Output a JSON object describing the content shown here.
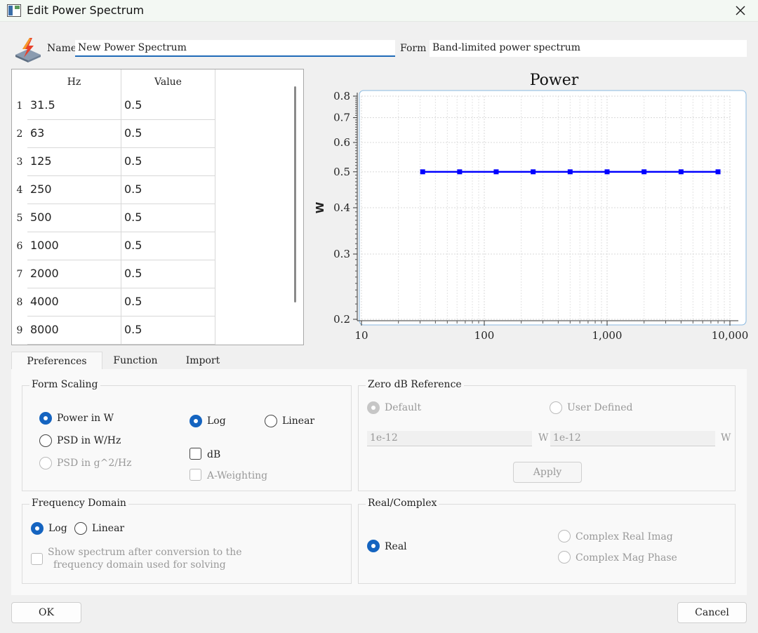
{
  "window": {
    "title": "Edit Power Spectrum"
  },
  "header": {
    "name_label": "Name",
    "name_value": "New Power Spectrum",
    "form_label": "Form",
    "form_value": "Band-limited power spectrum"
  },
  "table": {
    "columns": [
      "Hz",
      "Value"
    ],
    "rows": [
      {
        "num": "1",
        "hz": "31.5",
        "value": "0.5"
      },
      {
        "num": "2",
        "hz": "63",
        "value": "0.5"
      },
      {
        "num": "3",
        "hz": "125",
        "value": "0.5"
      },
      {
        "num": "4",
        "hz": "250",
        "value": "0.5"
      },
      {
        "num": "5",
        "hz": "500",
        "value": "0.5"
      },
      {
        "num": "6",
        "hz": "1000",
        "value": "0.5"
      },
      {
        "num": "7",
        "hz": "2000",
        "value": "0.5"
      },
      {
        "num": "8",
        "hz": "4000",
        "value": "0.5"
      },
      {
        "num": "9",
        "hz": "8000",
        "value": "0.5"
      }
    ]
  },
  "chart_data": {
    "type": "line",
    "title": "Power",
    "xlabel": "",
    "ylabel": "W",
    "x_scale": "log",
    "y_scale": "log",
    "xlim": [
      10,
      10000
    ],
    "ylim": [
      0.2,
      0.8
    ],
    "grid": true,
    "x_ticks": [
      10,
      100,
      1000,
      10000
    ],
    "x_tick_labels": [
      "10",
      "100",
      "1,000",
      "10,000"
    ],
    "y_ticks": [
      0.2,
      0.3,
      0.4,
      0.5,
      0.6,
      0.7,
      0.8
    ],
    "y_tick_labels": [
      "0.2",
      "0.3",
      "0.4",
      "0.5",
      "0.6",
      "0.7",
      "0.8"
    ],
    "series_color": "#0000ff",
    "series": [
      {
        "x": [
          31.5,
          63,
          125,
          250,
          500,
          1000,
          2000,
          4000,
          8000
        ],
        "values": [
          0.5,
          0.5,
          0.5,
          0.5,
          0.5,
          0.5,
          0.5,
          0.5,
          0.5
        ]
      }
    ]
  },
  "tabs": [
    {
      "label": "Preferences",
      "active": true
    },
    {
      "label": "Function",
      "active": false
    },
    {
      "label": "Import",
      "active": false
    }
  ],
  "form_scaling": {
    "title": "Form  Scaling",
    "power_w": "Power in W",
    "psd_w_hz": "PSD in W/Hz",
    "psd_g2_hz": "PSD in g^2/Hz",
    "log": "Log",
    "linear": "Linear",
    "db": "dB",
    "a_weighting": "A-Weighting"
  },
  "zero_db": {
    "title": "Zero dB Reference",
    "default": "Default",
    "user_defined": "User Defined",
    "value1": "1e-12",
    "unit1": "W",
    "value2": "1e-12",
    "unit2": "W",
    "apply": "Apply"
  },
  "frequency_domain": {
    "title": "Frequency Domain",
    "log": "Log",
    "linear": "Linear",
    "show_line1": "Show spectrum after conversion to the",
    "show_line2": "frequency domain used for solving"
  },
  "real_complex": {
    "title": "Real/Complex",
    "real": "Real",
    "complex_real_imag": "Complex Real  Imag",
    "complex_mag_phase": "Complex Mag  Phase"
  },
  "buttons": {
    "ok": "OK",
    "cancel": "Cancel"
  },
  "colors": {
    "accent": "#1564c0",
    "line": "#0000ff",
    "plot_border": "#88b8e0"
  }
}
